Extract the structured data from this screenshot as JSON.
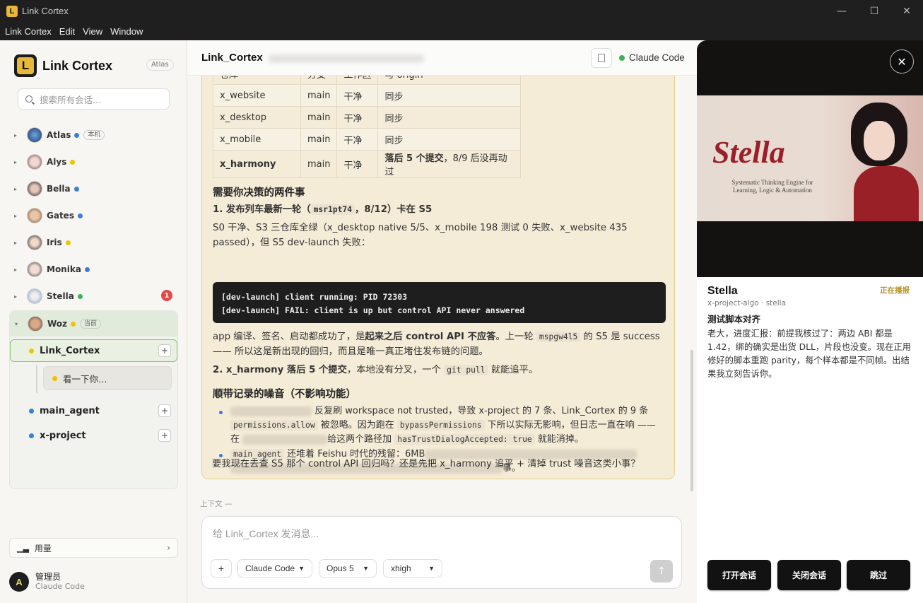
{
  "window": {
    "title": "Link Cortex",
    "app_letter": "L"
  },
  "menu": [
    "Link Cortex",
    "Edit",
    "View",
    "Window"
  ],
  "sidebar": {
    "brand": "Link Cortex",
    "brand_badge": "Atlas",
    "search_placeholder": "搜索所有会话...",
    "agents": [
      {
        "name": "Atlas",
        "status": "blue",
        "tag": "本机"
      },
      {
        "name": "Alys",
        "status": "yellow"
      },
      {
        "name": "Bella",
        "status": "blue"
      },
      {
        "name": "Gates",
        "status": "blue"
      },
      {
        "name": "Iris",
        "status": "yellow"
      },
      {
        "name": "Monika",
        "status": "blue"
      },
      {
        "name": "Stella",
        "status": "green",
        "unread": "1"
      },
      {
        "name": "Woz",
        "status": "yellow",
        "tag": "当前"
      }
    ],
    "sessions": [
      {
        "name": "Link_Cortex",
        "status": "yellow"
      },
      {
        "name": "看一下你…",
        "status": "yellow"
      },
      {
        "name": "main_agent",
        "status": "blue"
      },
      {
        "name": "x-project",
        "status": "blue"
      }
    ],
    "usage_label": "用量",
    "user": {
      "initial": "A",
      "name": "管理员",
      "engine": "Claude Code"
    }
  },
  "main": {
    "title": "Link_Cortex",
    "engine_status": "Claude Code",
    "table": {
      "headers": [
        "仓库",
        "分支",
        "工作区",
        "与 origin"
      ],
      "rows": [
        [
          "x_website",
          "main",
          "干净",
          "同步"
        ],
        [
          "x_desktop",
          "main",
          "干净",
          "同步"
        ],
        [
          "x_mobile",
          "main",
          "干净",
          "同步"
        ],
        [
          "x_harmony",
          "main",
          "干净",
          "落后 5 个提交",
          "，8/9 后没再动过"
        ]
      ]
    },
    "h_decide": "需要你决策的两件事",
    "item1": {
      "pre": "1. 发布列车最新一轮（",
      "code": "msr1pt74",
      "post": "，8/12）卡在 S5"
    },
    "p1": "S0 干净、S3 三仓库全绿（x_desktop native 5/5、x_mobile 198 测试 0 失败、x_website 435 passed），但 S5 dev-launch 失败：",
    "code_lines": [
      "[dev-launch] client running: PID 72303",
      "[dev-launch] FAIL: client is up but control API never answered"
    ],
    "p2": {
      "a": "app 编译、签名、启动都成功了，是",
      "b": "起来之后 control API 不应答",
      "c": "。上一轮 ",
      "code": "mspgw4l5",
      "d": " 的 S5 是 success —— 所以这是新出现的回归，而且是唯一真正堵住发布链的问题。"
    },
    "item2": {
      "a": "2. x_harmony 落后 5 个提交",
      "b": "，本地没有分叉，一个 ",
      "code": "git pull",
      "c": " 就能追平。"
    },
    "h_noise": "顺带记录的噪音（不影响功能）",
    "b1": {
      "a": " 反复刷 workspace not trusted，导致 x-project 的 7 条、Link_Cortex 的 9 条 ",
      "code1": "permissions.allow",
      "b": " 被忽略。因为跑在 ",
      "code2": "bypassPermissions",
      "c": " 下所以实际无影响，但日志一直在响 —— 在 ",
      "d": "给这两个路径加 ",
      "code3": "hasTrustDialogAccepted: true",
      "e": " 就能消掉。"
    },
    "b2": {
      "code": "main_agent",
      "a": " 还堆着 Feishu 时代的残留：6MB",
      "b": "事。"
    },
    "p_last": "要我现在去查 S5 那个 control API 回归吗？还是先把 x_harmony 追平 + 清掉 trust 噪音这类小事？",
    "context_label": "上下文 —",
    "composer": {
      "placeholder": "给 Link_Cortex 发消息...",
      "engine": "Claude Code",
      "model": "Opus 5",
      "effort": "xhigh",
      "add": "+"
    }
  },
  "panel": {
    "hero_title": "Stella",
    "hero_sub": "Systematic Thinking Engine for Learning, Logic & Automation",
    "name": "Stella",
    "live": "正在播报",
    "meta": "x-project-algo · stella",
    "task": "测试脚本对齐",
    "message": "老大，进度汇报：前提我核过了：两边 ABI 都是 1.42，绑的确实是出货 DLL，片段也没变。现在正用修好的脚本重跑 parity，每个样本都是不同帧。出结果我立刻告诉你。",
    "buttons": [
      "打开会话",
      "关闭会话",
      "跳过"
    ]
  },
  "colors": {
    "blue": "#3b7ddd",
    "yellow": "#f2c200",
    "green": "#3cb25a",
    "accent": "#e8b83a"
  }
}
